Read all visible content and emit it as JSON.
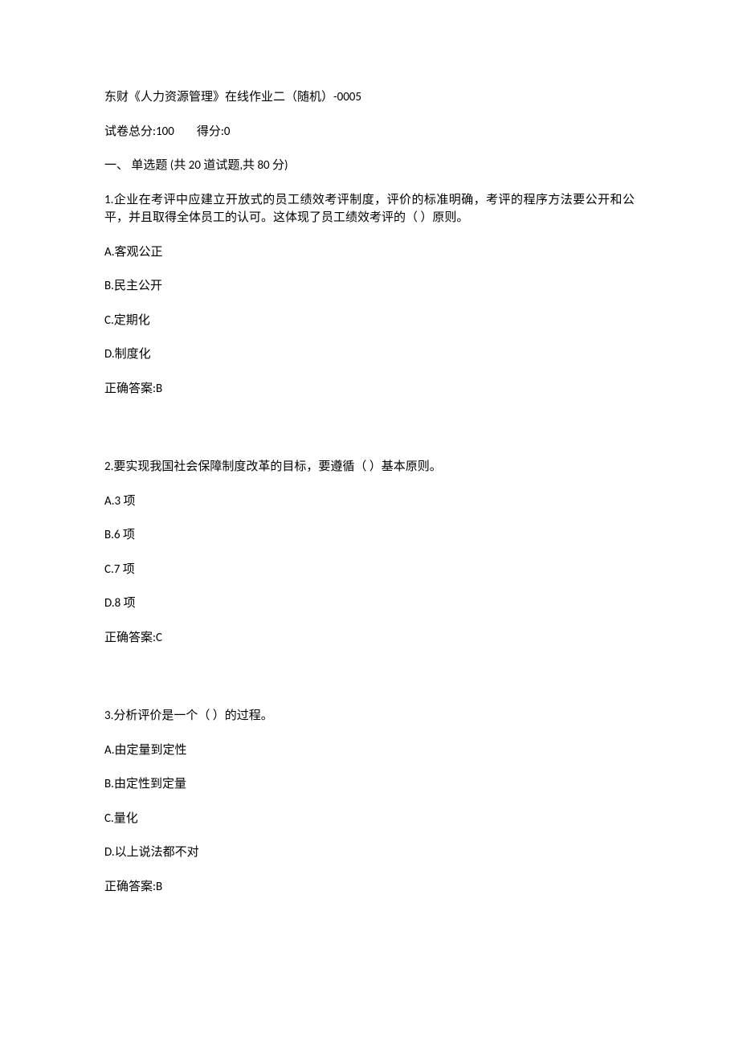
{
  "title": "东财《人力资源管理》在线作业二（随机）-0005",
  "meta": {
    "total_label": "试卷总分:",
    "total_value": "100",
    "score_label": "得分:",
    "score_value": "0"
  },
  "section": "一、  单选题 (共 20 道试题,共 80 分)",
  "questions": [
    {
      "text": "1.企业在考评中应建立开放式的员工绩效考评制度，评价的标准明确，考评的程序方法要公开和公平，并且取得全体员工的认可。这体现了员工绩效考评的（ ）原则。",
      "options": {
        "A": "A.客观公正",
        "B": "B.民主公开",
        "C": "C.定期化",
        "D": "D.制度化"
      },
      "answer": "正确答案:B"
    },
    {
      "text": "2.要实现我国社会保障制度改革的目标，要遵循（ ）基本原则。",
      "options": {
        "A": "A.3 项",
        "B": "B.6 项",
        "C": "C.7 项",
        "D": "D.8 项"
      },
      "answer": "正确答案:C"
    },
    {
      "text": "3.分析评价是一个（ ）的过程。",
      "options": {
        "A": "A.由定量到定性",
        "B": "B.由定性到定量",
        "C": "C.量化",
        "D": "D.以上说法都不对"
      },
      "answer": "正确答案:B"
    }
  ]
}
